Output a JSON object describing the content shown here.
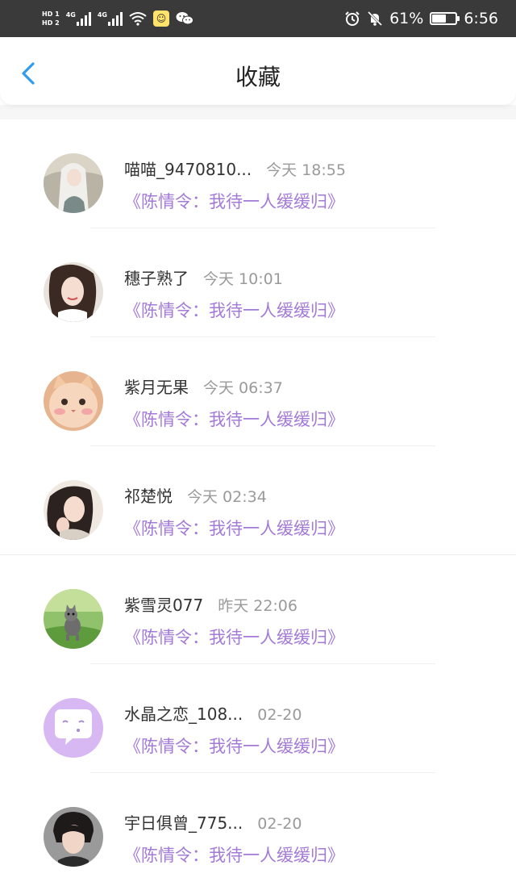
{
  "status_bar": {
    "hd1": "HD 1",
    "hd2": "HD 2",
    "net1": "4G",
    "net2": "4G",
    "battery_percent": "61%",
    "time": "6:56",
    "icons": [
      "signal-icon",
      "wifi-icon",
      "app-icon",
      "wechat-icon",
      "alarm-icon",
      "mute-icon",
      "battery-icon"
    ]
  },
  "header": {
    "title": "收藏",
    "back_icon": "chevron-left-icon",
    "accent": "#2f9cf0"
  },
  "colors": {
    "work_title": "#a37ad6",
    "time": "#9a9a9a"
  },
  "items": [
    {
      "name": "喵喵_9470810...",
      "time": "今天 18:55",
      "work": "《陈情令：我待一人缓缓归》",
      "avatar": "anime-character-avatar"
    },
    {
      "name": "穗子熟了",
      "time": "今天 10:01",
      "work": "《陈情令：我待一人缓缓归》",
      "avatar": "girl-photo-avatar"
    },
    {
      "name": "紫月无果",
      "time": "今天 06:37",
      "work": "《陈情令：我待一人缓缓归》",
      "avatar": "cat-avatar"
    },
    {
      "name": "祁楚悦",
      "time": "今天 02:34",
      "work": "《陈情令：我待一人缓缓归》",
      "avatar": "girl-photo-avatar"
    },
    {
      "name": "紫雪灵077",
      "time": "昨天 22:06",
      "work": "《陈情令：我待一人缓缓归》",
      "avatar": "kitten-grass-avatar"
    },
    {
      "name": "水晶之恋_108...",
      "time": "02-20",
      "work": "《陈情令：我待一人缓缓归》",
      "avatar": "default-chat-avatar"
    },
    {
      "name": "宇日俱曾_775...",
      "time": "02-20",
      "work": "《陈情令：我待一人缓缓归》",
      "avatar": "boy-photo-avatar"
    }
  ]
}
